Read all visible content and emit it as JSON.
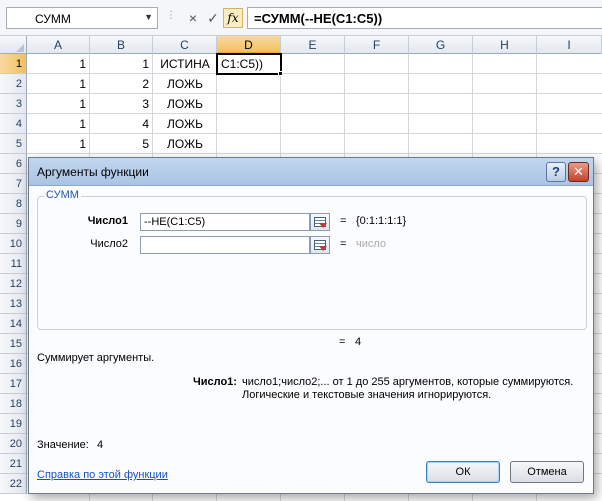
{
  "formula_bar": {
    "name_box": "СУММ",
    "cancel_icon": "×",
    "enter_icon": "✓",
    "fx_label": "fx",
    "formula": "=СУММ(--НЕ(C1:C5))"
  },
  "columns": [
    "A",
    "B",
    "C",
    "D",
    "E",
    "F",
    "G",
    "H",
    "I"
  ],
  "rows": [
    "1",
    "2",
    "3",
    "4",
    "5",
    "6",
    "7",
    "8",
    "9",
    "10",
    "11",
    "12",
    "13",
    "14",
    "15",
    "16",
    "17",
    "18",
    "19",
    "20",
    "21",
    "22"
  ],
  "cells": {
    "A": [
      "1",
      "1",
      "1",
      "1",
      "1"
    ],
    "B": [
      "1",
      "2",
      "3",
      "4",
      "5"
    ],
    "C": [
      "ИСТИНА",
      "ЛОЖЬ",
      "ЛОЖЬ",
      "ЛОЖЬ",
      "ЛОЖЬ"
    ],
    "D1": "C1:C5))"
  },
  "dialog": {
    "title": "Аргументы функции",
    "help_label": "?",
    "close_label": "✕",
    "group_label": "СУММ",
    "arg1": {
      "label": "Число1",
      "value": "--НЕ(C1:C5)",
      "result": "{0:1:1:1:1}"
    },
    "arg2": {
      "label": "Число2",
      "value": "",
      "result": "число"
    },
    "equals": "=",
    "formula_result": "4",
    "description": "Суммирует аргументы.",
    "arg_help_title": "Число1:",
    "arg_help_line1": "число1;число2;... от 1 до 255 аргументов, которые суммируются.",
    "arg_help_line2": "Логические и текстовые значения игнорируются.",
    "value_label": "Значение:",
    "value": "4",
    "help_link": "Справка по этой функции",
    "ok_label": "ОК",
    "cancel_label": "Отмена"
  }
}
